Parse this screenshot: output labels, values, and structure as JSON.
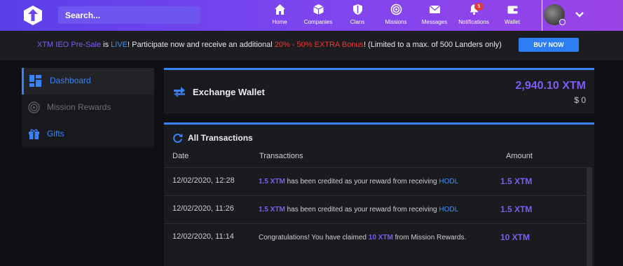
{
  "topnav": {
    "search_placeholder": "Search...",
    "items": [
      {
        "label": "Home",
        "icon": "home-icon"
      },
      {
        "label": "Companies",
        "icon": "cube-icon"
      },
      {
        "label": "Clans",
        "icon": "shield-icon"
      },
      {
        "label": "Missions",
        "icon": "target-icon"
      },
      {
        "label": "Messages",
        "icon": "envelope-icon"
      },
      {
        "label": "Notifications",
        "icon": "bell-icon",
        "badge": "5"
      },
      {
        "label": "Wallet",
        "icon": "wallet-icon"
      }
    ]
  },
  "banner": {
    "xtm": "XTM IEO Pre-Sale",
    "is": " is ",
    "live": "LIVE",
    "mid": "! Participate now and receive an additional ",
    "bonus": "20% - 50% EXTRA Bonus",
    "end": "! (Limited to a max. of 500 Landers only)",
    "buy_label": "BUY NOW"
  },
  "sidebar": {
    "items": [
      {
        "label": "Dashboard",
        "icon": "dashboard-icon",
        "active": true
      },
      {
        "label": "Mission Rewards",
        "icon": "target-icon",
        "active": false
      },
      {
        "label": "Gifts",
        "icon": "gift-icon",
        "active": false
      }
    ]
  },
  "wallet": {
    "title": "Exchange Wallet",
    "amount": "2,940.10 XTM",
    "usd": "$ 0"
  },
  "transactions": {
    "title": "All Transactions",
    "headers": {
      "date": "Date",
      "transactions": "Transactions",
      "amount": "Amount"
    },
    "rows": [
      {
        "date": "12/02/2020, 12:28",
        "pre": "",
        "hl": "1.5 XTM",
        "mid": " has been credited as your reward from receiving ",
        "link": "HODL",
        "post": "",
        "amount": "1.5 XTM"
      },
      {
        "date": "12/02/2020, 11:26",
        "pre": "",
        "hl": "1.5 XTM",
        "mid": " has been credited as your reward from receiving ",
        "link": "HODL",
        "post": "",
        "amount": "1.5 XTM"
      },
      {
        "date": "12/02/2020, 11:14",
        "pre": "Congratulations! You have claimed ",
        "hl": "10 XTM",
        "mid": " from Mission Rewards.",
        "link": "",
        "post": "",
        "amount": "10 XTM"
      }
    ]
  },
  "colors": {
    "accent": "#7f5cf5",
    "blue": "#3b82f6",
    "red": "#e53a3a",
    "nav_gradient_start": "#5a3fe8",
    "nav_gradient_end": "#9a44e6"
  }
}
